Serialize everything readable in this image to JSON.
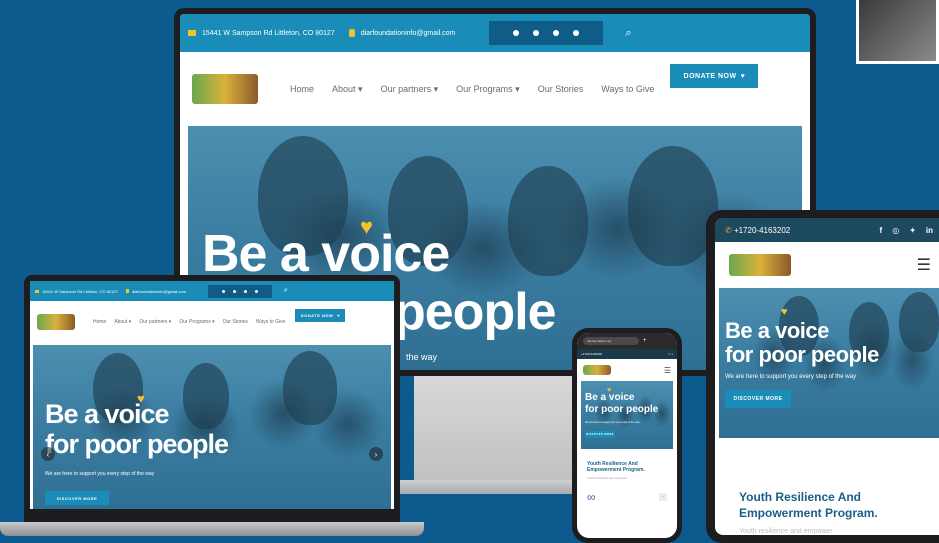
{
  "site": {
    "address": "15441 W Sampson Rd Littleton, CO 80127",
    "email": "diarfoundationinfo@gmail.com",
    "phone": "+1720-4163202",
    "nav": [
      "Home",
      "About",
      "Our partners",
      "Our Programs",
      "Our Stories",
      "Ways to Give"
    ],
    "donate_label": "DONATE NOW",
    "headline_line1": "Be a voice",
    "headline_line2": "for poor people",
    "headline_line2_partial": "people",
    "subtitle": "We are here to support you every step of the way",
    "subtitle_partial": "the way",
    "discover_label": "DISCOVER MORE",
    "program_title_line1": "Youth Resilience And",
    "program_title_line2": "Empowerment Program.",
    "program_text": "Youth resilience and empower",
    "phone_url": "diarfoundation.org"
  },
  "icons": {
    "pin": "map-pin-icon",
    "mail": "mail-icon",
    "facebook": "facebook-icon",
    "twitter": "twitter-icon",
    "instagram": "instagram-icon",
    "pinterest": "pinterest-icon",
    "linkedin": "linkedin-icon",
    "search": "search-icon",
    "menu": "hamburger-menu-icon",
    "heart": "heart-icon"
  },
  "colors": {
    "background": "#0d5a8f",
    "brand": "#1a8cb8",
    "accent": "#f2c230",
    "program_title": "#1a5f8a"
  }
}
